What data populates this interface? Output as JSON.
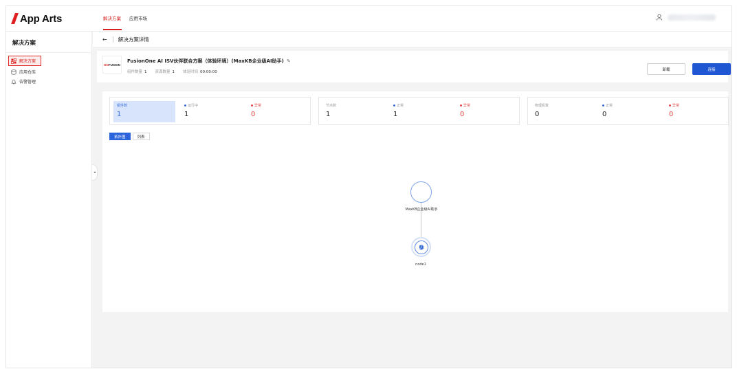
{
  "app": {
    "logo_text": "App Arts",
    "brand_color": "#d7201f",
    "primary_color": "#1f56d1"
  },
  "top_nav": {
    "tabs": [
      {
        "label": "解决方案",
        "active": true
      },
      {
        "label": "应用市场",
        "active": false
      }
    ],
    "user_icon": "user-icon"
  },
  "sidebar": {
    "title": "解决方案",
    "items": [
      {
        "label": "解决方案",
        "icon": "solution-icon",
        "active": true
      },
      {
        "label": "应用仓库",
        "icon": "repository-icon",
        "active": false
      },
      {
        "label": "告警管理",
        "icon": "alarm-icon",
        "active": false
      }
    ]
  },
  "breadcrumb": {
    "back_icon": "arrow-left-icon",
    "title": "解决方案详情"
  },
  "solution": {
    "logo_text_red": "OO",
    "logo_text": "FUSION",
    "title": "FusionOne AI ISV伙伴联合方案（体验环境）(MaxKB企业级AI助手)",
    "meta": [
      {
        "label": "组件数量",
        "value": "1"
      },
      {
        "label": "资源数量",
        "value": "1"
      },
      {
        "label": "体验时间",
        "value": "00:00:00"
      }
    ],
    "uninstall_label": "卸载",
    "connect_label": "连接"
  },
  "stats": [
    {
      "label": "组件数",
      "value": "1"
    },
    {
      "label": "运行中",
      "value": "1"
    },
    {
      "label": "异常",
      "value": "0"
    },
    {
      "label": "节点数",
      "value": "1"
    },
    {
      "label": "正常",
      "value": "1"
    },
    {
      "label": "异常",
      "value": "0"
    },
    {
      "label": "物理机数",
      "value": "0"
    },
    {
      "label": "正常",
      "value": "0"
    },
    {
      "label": "异常",
      "value": "0"
    }
  ],
  "view_tabs": [
    {
      "label": "拓扑图",
      "active": true
    },
    {
      "label": "列表",
      "active": false
    }
  ],
  "topology": {
    "solution_label": "MaxKB企业级AI助手",
    "node_label": "node1"
  }
}
